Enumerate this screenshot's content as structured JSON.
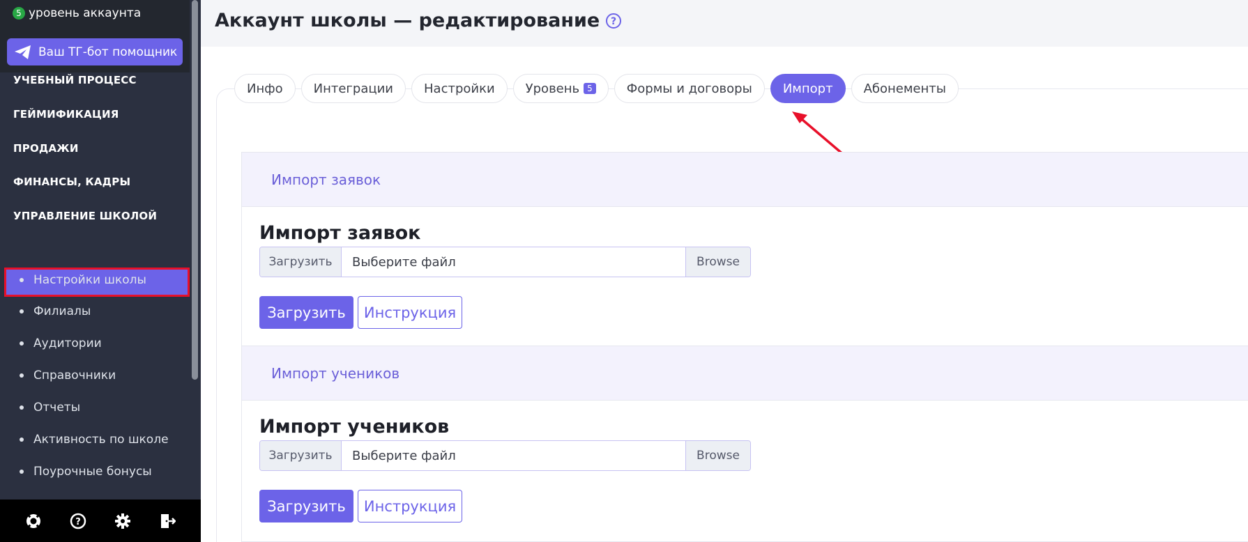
{
  "sidebar": {
    "level_badge": "5",
    "level_text": "уровень аккаунта",
    "tg_button": "Ваш ТГ-бот помощник",
    "sections": [
      "УЧЕБНЫЙ ПРОЦЕСС",
      "ГЕЙМИФИКАЦИЯ",
      "ПРОДАЖИ",
      "ФИНАНСЫ, КАДРЫ",
      "УПРАВЛЕНИЕ ШКОЛОЙ"
    ],
    "items": [
      "Настройки школы",
      "Филиалы",
      "Аудитории",
      "Справочники",
      "Отчеты",
      "Активность по школе",
      "Поурочные бонусы"
    ],
    "active_item_index": 0,
    "bottom_icons": [
      "lifebuoy-icon",
      "help-circle-icon",
      "gear-icon",
      "logout-icon"
    ]
  },
  "header": {
    "title": "Аккаунт школы — редактирование"
  },
  "tabs": [
    {
      "label": "Инфо"
    },
    {
      "label": "Интеграции"
    },
    {
      "label": "Настройки"
    },
    {
      "label": "Уровень",
      "badge": "5"
    },
    {
      "label": "Формы и договоры"
    },
    {
      "label": "Импорт",
      "active": true
    },
    {
      "label": "Абонементы"
    }
  ],
  "import_cards": [
    {
      "header": "Импорт заявок",
      "title": "Импорт заявок",
      "file_prefix": "Загрузить",
      "file_placeholder": "Выберите файл",
      "browse_label": "Browse",
      "upload_button": "Загрузить",
      "instruction_button": "Инструкция"
    },
    {
      "header": "Импорт учеников",
      "title": "Импорт учеников",
      "file_prefix": "Загрузить",
      "file_placeholder": "Выберите файл",
      "browse_label": "Browse",
      "upload_button": "Загрузить",
      "instruction_button": "Инструкция"
    }
  ],
  "colors": {
    "accent": "#6c63e8",
    "sidebar_bg": "#2b3040",
    "highlight_border": "#e8102a",
    "arrow": "#e8102a"
  }
}
